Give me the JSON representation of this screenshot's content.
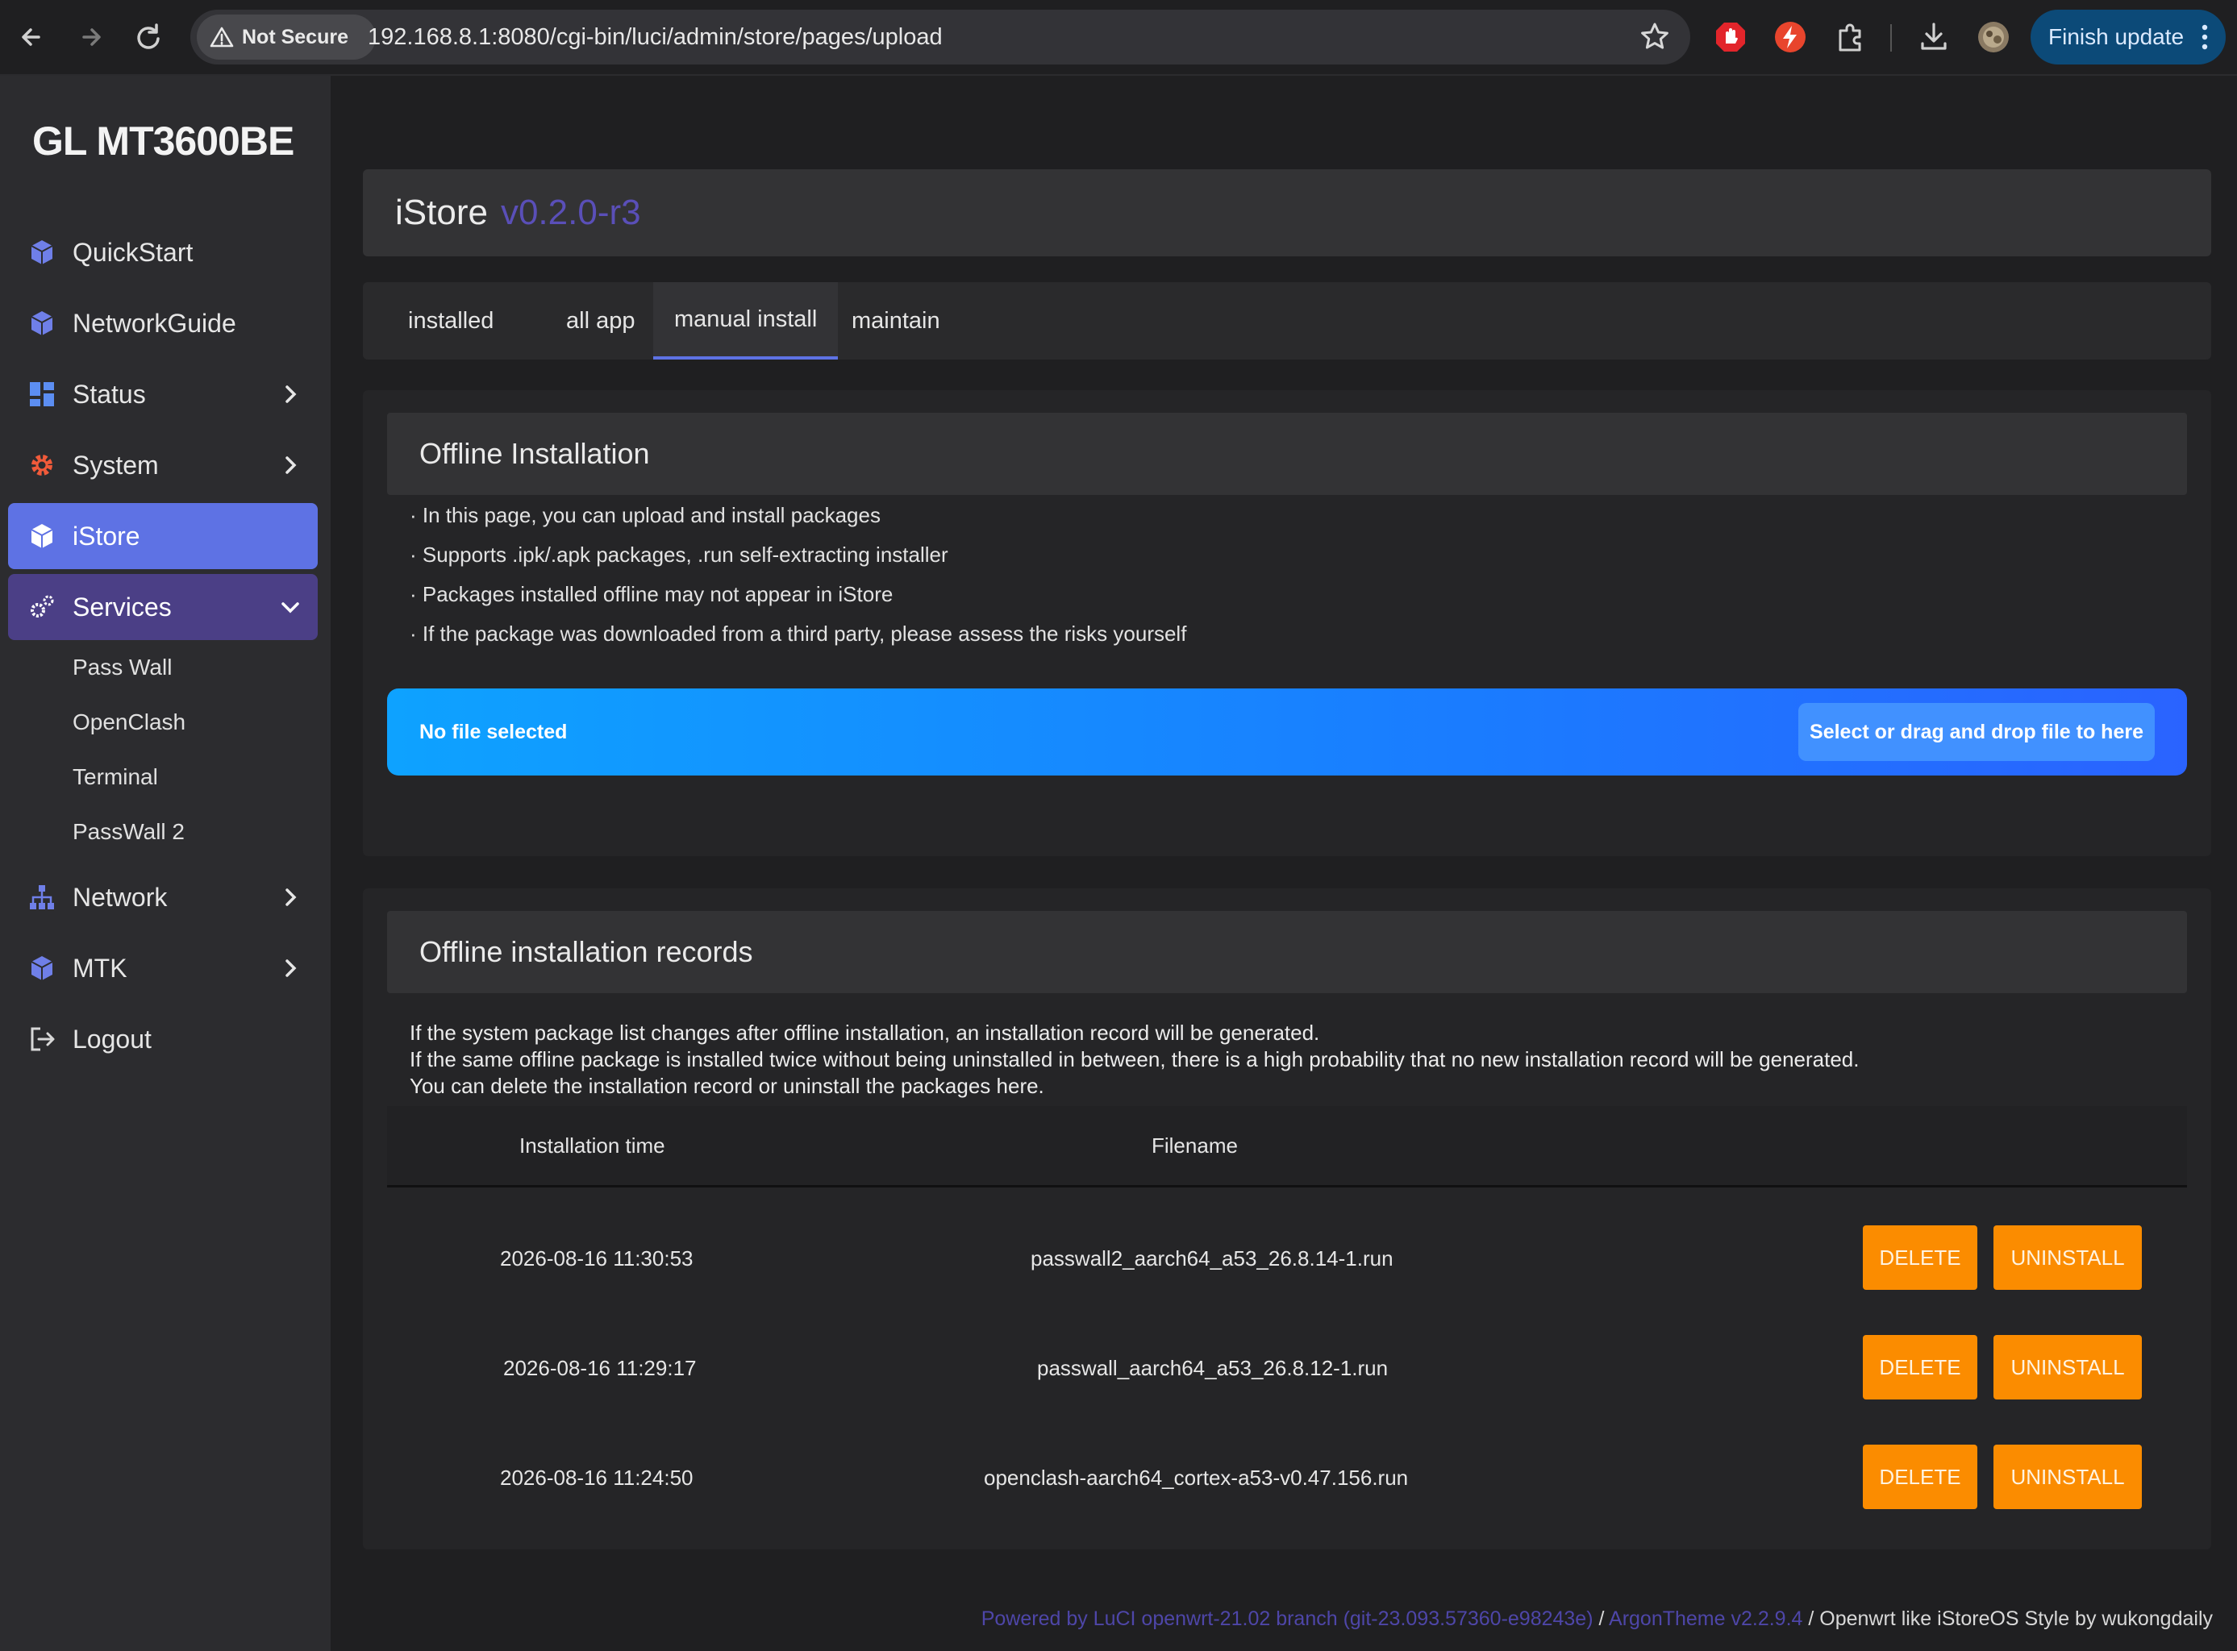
{
  "browser": {
    "security_label": "Not Secure",
    "url": "192.168.8.1:8080/cgi-bin/luci/admin/store/pages/upload",
    "finish_update_label": "Finish update"
  },
  "sidebar": {
    "brand": "GL MT3600BE",
    "items": [
      {
        "label": "QuickStart",
        "icon": "cube-icon"
      },
      {
        "label": "NetworkGuide",
        "icon": "cube-icon"
      },
      {
        "label": "Status",
        "icon": "dashboard-icon"
      },
      {
        "label": "System",
        "icon": "gear-icon"
      },
      {
        "label": "iStore",
        "icon": "cube-icon"
      },
      {
        "label": "Services",
        "icon": "gears-icon"
      },
      {
        "label": "Network",
        "icon": "network-icon"
      },
      {
        "label": "MTK",
        "icon": "cube-icon"
      },
      {
        "label": "Logout",
        "icon": "logout-icon"
      }
    ],
    "services_sub": [
      "Pass Wall",
      "OpenClash",
      "Terminal",
      "PassWall 2"
    ]
  },
  "header": {
    "title": "iStore",
    "version": "v0.2.0-r3"
  },
  "tabs": [
    "installed",
    "all app",
    "manual install",
    "maintain"
  ],
  "offline": {
    "heading": "Offline Installation",
    "notes": [
      "· In this page, you can upload and install packages",
      "· Supports .ipk/.apk packages, .run self-extracting installer",
      "· Packages installed offline may not appear in iStore",
      "· If the package was downloaded from a third party, please assess the risks yourself"
    ],
    "no_file": "No file selected",
    "select_label": "Select or drag and drop file to here"
  },
  "records": {
    "heading": "Offline installation records",
    "text": [
      "If the system package list changes after offline installation, an installation record will be generated.",
      "If the same offline package is installed twice without being uninstalled in between, there is a high probability that no new installation record will be generated.",
      "You can delete the installation record or uninstall the packages here."
    ],
    "columns": [
      "Installation time",
      "Filename"
    ],
    "rows": [
      {
        "time": "2026-08-16 11:30:53",
        "file": "passwall2_aarch64_a53_26.8.14-1.run"
      },
      {
        "time": "2026-08-16 11:29:17",
        "file": "passwall_aarch64_a53_26.8.12-1.run"
      },
      {
        "time": "2026-08-16 11:24:50",
        "file": "openclash-aarch64_cortex-a53-v0.47.156.run"
      }
    ],
    "delete_label": "DELETE",
    "uninstall_label": "UNINSTALL"
  },
  "footer": {
    "luci": "Powered by LuCI openwrt-21.02 branch (git-23.093.57360-e98243e)",
    "sep1": " / ",
    "theme": "ArgonTheme v2.2.9.4",
    "rest": " / Openwrt like iStoreOS Style by wukongdaily"
  },
  "colors": {
    "accent": "#5e72e4",
    "services_open": "#4b3f86",
    "upload_gradient_start": "#0ea2ff",
    "upload_gradient_end": "#2a63ff",
    "action_orange": "#fb8c00",
    "version_purple": "#5a4fb8"
  }
}
